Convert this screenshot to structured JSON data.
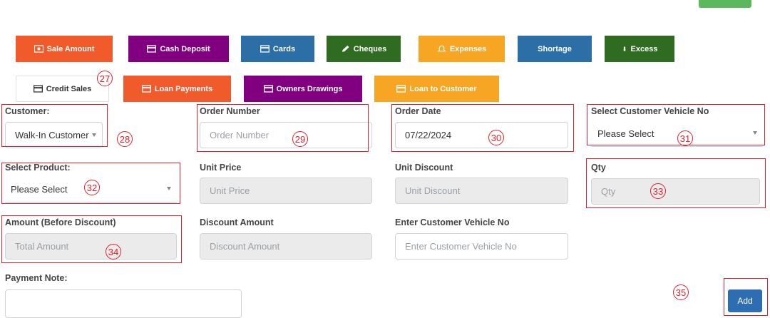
{
  "tabs_row1": [
    {
      "label": "Sale Amount",
      "icon": "money-icon",
      "color": "#f15a2b"
    },
    {
      "label": "Cash Deposit",
      "icon": "card-icon",
      "color": "#800080"
    },
    {
      "label": "Cards",
      "icon": "card-icon",
      "color": "#2c6fa7"
    },
    {
      "label": "Cheques",
      "icon": "pencil-icon",
      "color": "#2f6b20"
    },
    {
      "label": "Expenses",
      "icon": "bell-icon",
      "color": "#f6a623"
    },
    {
      "label": "Shortage",
      "icon": "",
      "color": "#2c6fa7"
    },
    {
      "label": "Excess",
      "icon": "thermometer-icon",
      "color": "#2f6b20"
    }
  ],
  "tabs_row2": [
    {
      "label": "Credit Sales",
      "icon": "card-icon",
      "color": "#ffffff"
    },
    {
      "label": "Loan Payments",
      "icon": "card-icon",
      "color": "#f15a2b"
    },
    {
      "label": "Owners Drawings",
      "icon": "card-icon",
      "color": "#800080"
    },
    {
      "label": "Loan to Customer",
      "icon": "card-icon",
      "color": "#f6a623"
    }
  ],
  "form": {
    "customer": {
      "label": "Customer:",
      "value": "Walk-In Customer"
    },
    "order_number": {
      "label": "Order Number",
      "placeholder": "Order Number"
    },
    "order_date": {
      "label": "Order Date",
      "value": "07/22/2024"
    },
    "vehicle_select": {
      "label": "Select Customer Vehicle No",
      "value": "Please Select"
    },
    "product": {
      "label": "Select Product:",
      "value": "Please Select"
    },
    "unit_price": {
      "label": "Unit Price",
      "placeholder": "Unit Price"
    },
    "unit_discount": {
      "label": "Unit Discount",
      "placeholder": "Unit Discount"
    },
    "qty": {
      "label": "Qty",
      "placeholder": "Qty"
    },
    "amount": {
      "label": "Amount (Before Discount)",
      "placeholder": "Total Amount"
    },
    "discount_amount": {
      "label": "Discount Amount",
      "placeholder": "Discount Amount"
    },
    "vehicle_input": {
      "label": "Enter Customer Vehicle No",
      "placeholder": "Enter Customer Vehicle No"
    },
    "payment_note": {
      "label": "Payment Note:"
    },
    "add_label": "Add"
  },
  "annotations": [
    "27",
    "28",
    "29",
    "30",
    "31",
    "32",
    "33",
    "34",
    "35"
  ],
  "colors": {
    "annotation": "#d9232e",
    "primary": "#2f6db3",
    "green": "#5cb85c"
  }
}
